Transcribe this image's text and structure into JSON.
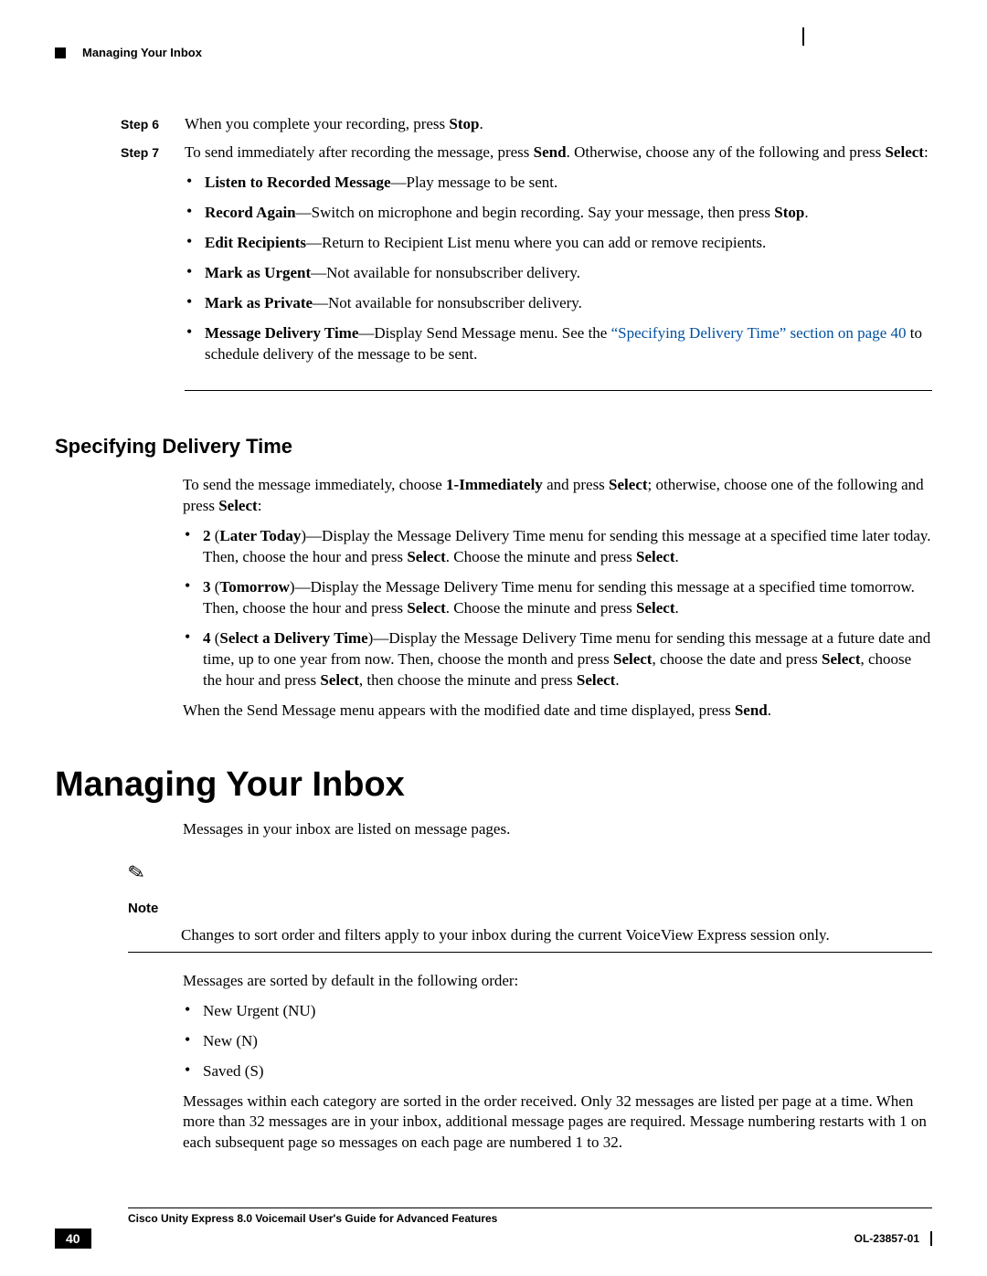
{
  "header": {
    "running_title": "Managing Your Inbox"
  },
  "steps": [
    {
      "label": "Step 6",
      "html": "When you complete your recording, press <b>Stop</b>."
    },
    {
      "label": "Step 7",
      "html": "To send immediately after recording the message, press <b>Send</b>. Otherwise, choose any of the following and press <b>Select</b>:",
      "bullets": [
        "<b>Listen to Recorded Message</b>—Play message to be sent.",
        "<b>Record Again</b>—Switch on microphone and begin recording. Say your message, then press <b>Stop</b>.",
        "<b>Edit Recipients</b>—Return to Recipient List menu where you can add or remove recipients.",
        "<b>Mark as Urgent</b>—Not available for nonsubscriber delivery.",
        "<b>Mark as Private</b>—Not available for nonsubscriber delivery.",
        "<b>Message Delivery Time</b>—Display Send Message menu. See the <span class=\"link\">“Specifying Delivery Time” section on page 40</span> to schedule delivery of the message to be sent."
      ]
    }
  ],
  "section2": {
    "title": "Specifying Delivery Time",
    "intro": "To send the message immediately, choose <b>1-Immediately</b> and press <b>Select</b>; otherwise, choose one of the following and press <b>Select</b>:",
    "bullets": [
      "<b>2</b> (<b>Later Today</b>)—Display the Message Delivery Time menu for sending this message at a specified time later today. Then, choose the hour and press <b>Select</b>. Choose the minute and press <b>Select</b>.",
      "<b>3</b> (<b>Tomorrow</b>)—Display the Message Delivery Time menu for sending this message at a specified time tomorrow. Then, choose the hour and press <b>Select</b>. Choose the minute and press <b>Select</b>.",
      "<b>4</b> (<b>Select a Delivery Time</b>)—Display the Message Delivery Time menu for sending this message at a future date and time, up to one year from now. Then, choose the month and press <b>Select</b>, choose the date and press <b>Select</b>, choose the hour and press <b>Select</b>, then choose the minute and press <b>Select</b>."
    ],
    "outro": "When the Send Message menu appears with the modified date and time displayed, press <b>Send</b>."
  },
  "section3": {
    "title": "Managing Your Inbox",
    "p1": "Messages in your inbox are listed on message pages.",
    "note_label": "Note",
    "note_text": "Changes to sort order and filters apply to your inbox during the current VoiceView Express session only.",
    "p2": "Messages are sorted by default in the following order:",
    "bullets": [
      "New Urgent (NU)",
      "New (N)",
      "Saved (S)"
    ],
    "p3": "Messages within each category are sorted in the order received. Only 32 messages are listed per page at a time. When more than 32 messages are in your inbox, additional message pages are required. Message numbering restarts with 1 on each subsequent page so messages on each page are numbered 1 to 32."
  },
  "footer": {
    "doc_title": "Cisco Unity Express 8.0 Voicemail User's Guide for Advanced Features",
    "page_num": "40",
    "doc_id": "OL-23857-01"
  }
}
